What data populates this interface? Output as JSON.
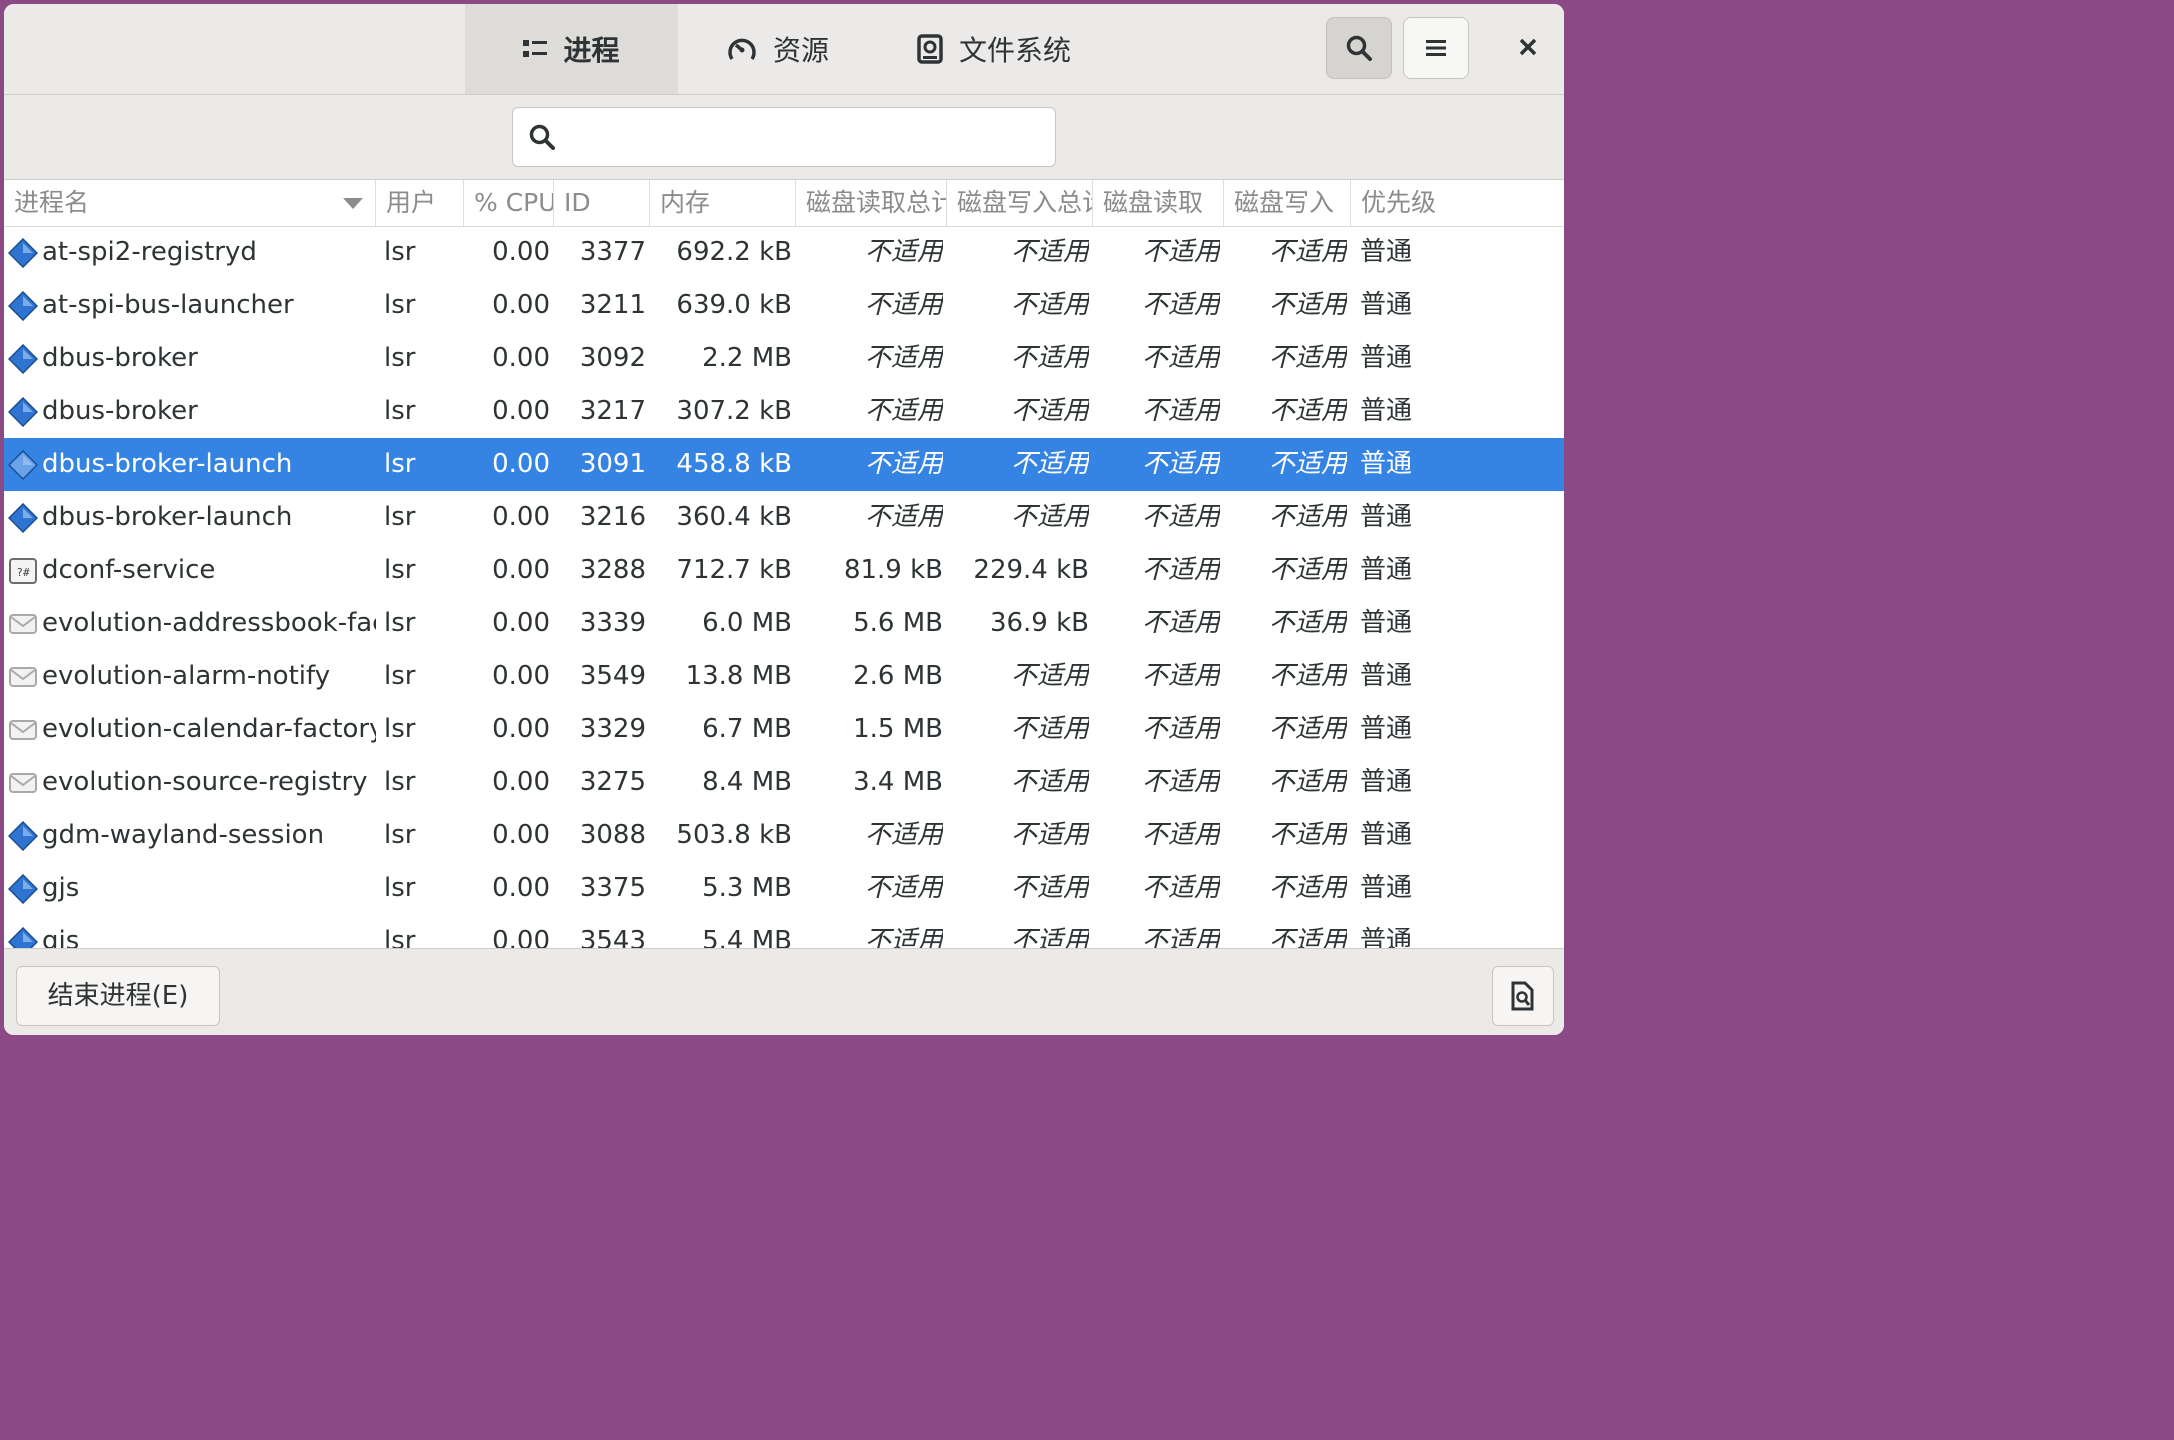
{
  "tabs": [
    {
      "label": "进程",
      "icon": "list-icon",
      "active": true
    },
    {
      "label": "资源",
      "icon": "gauge-icon",
      "active": false
    },
    {
      "label": "文件系统",
      "icon": "disk-icon",
      "active": false
    }
  ],
  "search": {
    "placeholder": "",
    "value": ""
  },
  "columns": [
    "进程名",
    "用户",
    "% CPU",
    "ID",
    "内存",
    "磁盘读取总计",
    "磁盘写入总计",
    "磁盘读取",
    "磁盘写入",
    "优先级"
  ],
  "rows": [
    {
      "name": "at-spi2-registryd",
      "icon": "executable-icon",
      "user": "lsr",
      "cpu": "0.00",
      "id": "3377",
      "mem": "692.2 kB",
      "disk_read_total": "不适用",
      "disk_write_total": "不适用",
      "disk_read": "不适用",
      "disk_write": "不适用",
      "priority": "普通"
    },
    {
      "name": "at-spi-bus-launcher",
      "icon": "executable-icon",
      "user": "lsr",
      "cpu": "0.00",
      "id": "3211",
      "mem": "639.0 kB",
      "disk_read_total": "不适用",
      "disk_write_total": "不适用",
      "disk_read": "不适用",
      "disk_write": "不适用",
      "priority": "普通"
    },
    {
      "name": "dbus-broker",
      "icon": "executable-icon",
      "user": "lsr",
      "cpu": "0.00",
      "id": "3092",
      "mem": "2.2 MB",
      "disk_read_total": "不适用",
      "disk_write_total": "不适用",
      "disk_read": "不适用",
      "disk_write": "不适用",
      "priority": "普通"
    },
    {
      "name": "dbus-broker",
      "icon": "executable-icon",
      "user": "lsr",
      "cpu": "0.00",
      "id": "3217",
      "mem": "307.2 kB",
      "disk_read_total": "不适用",
      "disk_write_total": "不适用",
      "disk_read": "不适用",
      "disk_write": "不适用",
      "priority": "普通"
    },
    {
      "name": "dbus-broker-launch",
      "icon": "executable-icon",
      "user": "lsr",
      "cpu": "0.00",
      "id": "3091",
      "mem": "458.8 kB",
      "disk_read_total": "不适用",
      "disk_write_total": "不适用",
      "disk_read": "不适用",
      "disk_write": "不适用",
      "priority": "普通",
      "selected": true
    },
    {
      "name": "dbus-broker-launch",
      "icon": "executable-icon",
      "user": "lsr",
      "cpu": "0.00",
      "id": "3216",
      "mem": "360.4 kB",
      "disk_read_total": "不适用",
      "disk_write_total": "不适用",
      "disk_read": "不适用",
      "disk_write": "不适用",
      "priority": "普通"
    },
    {
      "name": "dconf-service",
      "icon": "dconf-icon",
      "user": "lsr",
      "cpu": "0.00",
      "id": "3288",
      "mem": "712.7 kB",
      "disk_read_total": "81.9 kB",
      "disk_write_total": "229.4 kB",
      "disk_read": "不适用",
      "disk_write": "不适用",
      "priority": "普通"
    },
    {
      "name": "evolution-addressbook-factory",
      "icon": "evolution-icon",
      "user": "lsr",
      "cpu": "0.00",
      "id": "3339",
      "mem": "6.0 MB",
      "disk_read_total": "5.6 MB",
      "disk_write_total": "36.9 kB",
      "disk_read": "不适用",
      "disk_write": "不适用",
      "priority": "普通"
    },
    {
      "name": "evolution-alarm-notify",
      "icon": "evolution-icon",
      "user": "lsr",
      "cpu": "0.00",
      "id": "3549",
      "mem": "13.8 MB",
      "disk_read_total": "2.6 MB",
      "disk_write_total": "不适用",
      "disk_read": "不适用",
      "disk_write": "不适用",
      "priority": "普通"
    },
    {
      "name": "evolution-calendar-factory",
      "icon": "evolution-icon",
      "user": "lsr",
      "cpu": "0.00",
      "id": "3329",
      "mem": "6.7 MB",
      "disk_read_total": "1.5 MB",
      "disk_write_total": "不适用",
      "disk_read": "不适用",
      "disk_write": "不适用",
      "priority": "普通"
    },
    {
      "name": "evolution-source-registry",
      "icon": "evolution-icon",
      "user": "lsr",
      "cpu": "0.00",
      "id": "3275",
      "mem": "8.4 MB",
      "disk_read_total": "3.4 MB",
      "disk_write_total": "不适用",
      "disk_read": "不适用",
      "disk_write": "不适用",
      "priority": "普通"
    },
    {
      "name": "gdm-wayland-session",
      "icon": "executable-icon",
      "user": "lsr",
      "cpu": "0.00",
      "id": "3088",
      "mem": "503.8 kB",
      "disk_read_total": "不适用",
      "disk_write_total": "不适用",
      "disk_read": "不适用",
      "disk_write": "不适用",
      "priority": "普通"
    },
    {
      "name": "gjs",
      "icon": "executable-icon",
      "user": "lsr",
      "cpu": "0.00",
      "id": "3375",
      "mem": "5.3 MB",
      "disk_read_total": "不适用",
      "disk_write_total": "不适用",
      "disk_read": "不适用",
      "disk_write": "不适用",
      "priority": "普通"
    },
    {
      "name": "gjs",
      "icon": "executable-icon",
      "user": "lsr",
      "cpu": "0.00",
      "id": "3543",
      "mem": "5.4 MB",
      "disk_read_total": "不适用",
      "disk_write_total": "不适用",
      "disk_read": "不适用",
      "disk_write": "不适用",
      "priority": "普通"
    }
  ],
  "footer": {
    "end_process_label": "结束进程(E)"
  },
  "colors": {
    "accent": "#3584e4",
    "headerbar": "#ebeae8"
  }
}
